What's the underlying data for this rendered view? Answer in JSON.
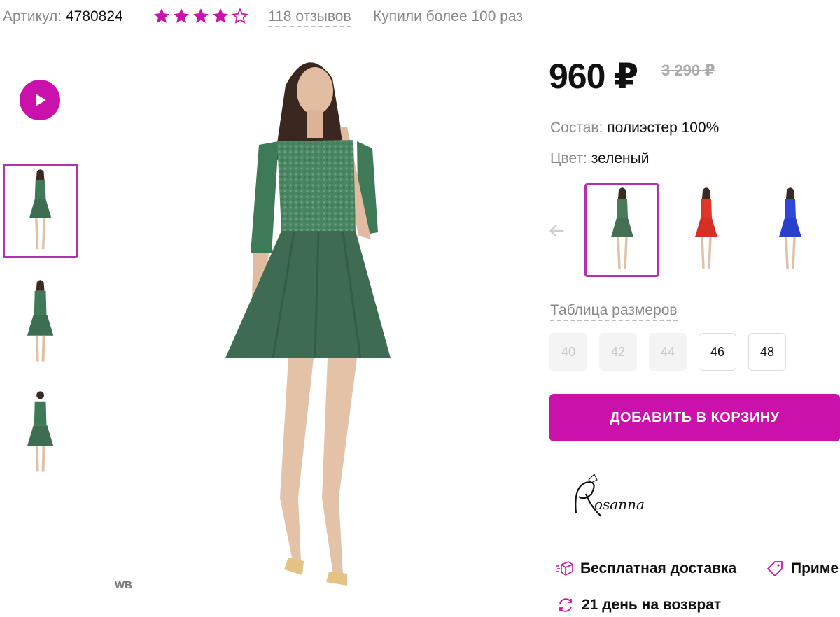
{
  "header": {
    "article_label": "Артикул:",
    "article_number": "4780824",
    "rating_stars": 4,
    "rating_max": 5,
    "reviews_text": "118 отзывов",
    "bought_text": "Купили более 100 раз"
  },
  "gallery": {
    "play_icon": "play-icon",
    "thumbnails": [
      "green-dress-front",
      "green-dress-front-2",
      "green-dress-back"
    ],
    "watermark": "WB"
  },
  "product": {
    "price": "960 ₽",
    "old_price": "3 290 ₽",
    "composition_label": "Состав:",
    "composition_value": "полиэстер 100%",
    "color_label": "Цвет:",
    "color_value": "зеленый",
    "color_options": [
      {
        "name": "green",
        "dress_color": "#4b7a5a"
      },
      {
        "name": "red",
        "dress_color": "#e0352b"
      },
      {
        "name": "blue",
        "dress_color": "#2f47d8"
      }
    ],
    "size_table_label": "Таблица размеров",
    "sizes": [
      {
        "label": "40",
        "available": false
      },
      {
        "label": "42",
        "available": false
      },
      {
        "label": "44",
        "available": false
      },
      {
        "label": "46",
        "available": true
      },
      {
        "label": "48",
        "available": true
      }
    ],
    "add_to_cart": "ДОБАВИТЬ В КОРЗИНУ",
    "brand": "Rosanna"
  },
  "features": {
    "free_delivery": "Бесплатная доставка",
    "try_on": "Приме",
    "return": "21 день на возврат"
  },
  "colors": {
    "accent": "#cb11ab",
    "muted_text": "#888888"
  }
}
